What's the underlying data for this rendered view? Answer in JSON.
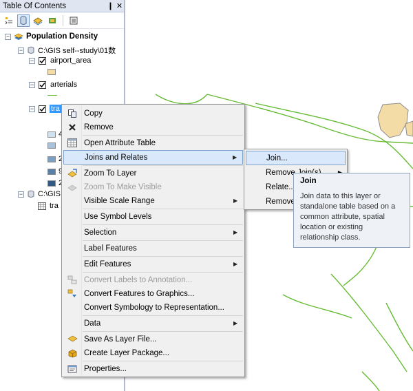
{
  "toc": {
    "title": "Table Of Contents",
    "pin_glyph": "❙",
    "close_glyph": "✕",
    "toolbar_icons": [
      "list-by-drawing-order-icon",
      "list-by-source-icon",
      "list-by-visibility-icon",
      "list-by-selection-icon",
      "options-icon"
    ],
    "root_layer": "Population Density",
    "workspace1": "C:\\GIS  self--study\\01数",
    "layers": [
      {
        "name": "airport_area",
        "checked": true,
        "swatch": "#f4dca6"
      },
      {
        "name": "arterials",
        "checked": true
      },
      {
        "name": "tra",
        "checked": true,
        "selected": true
      }
    ],
    "class_labels": [
      "4",
      "2",
      "2",
      "9",
      "2"
    ],
    "class_colors": [
      "#cfe0ee",
      "#a9c2db",
      "#7b9fc2",
      "#5a7fa6",
      "#2f5a86"
    ],
    "workspace2": "C:\\GIS",
    "table_item": "tra"
  },
  "context_menu": {
    "items": [
      {
        "label": "Copy",
        "icon": "copy-icon"
      },
      {
        "label": "Remove",
        "icon": "remove-icon"
      },
      {
        "label": "Open Attribute Table",
        "icon": "table-icon"
      },
      {
        "label": "Joins and Relates",
        "submenu": true,
        "highlighted": true
      },
      {
        "label": "Zoom To Layer",
        "icon": "zoom-to-layer-icon"
      },
      {
        "label": "Zoom To Make Visible",
        "icon": "zoom-visible-icon",
        "disabled": true
      },
      {
        "label": "Visible Scale Range",
        "submenu": true
      },
      {
        "label": "Use Symbol Levels"
      },
      {
        "label": "Selection",
        "submenu": true
      },
      {
        "label": "Label Features"
      },
      {
        "label": "Edit Features",
        "submenu": true
      },
      {
        "label": "Convert Labels to Annotation...",
        "icon": "convert-labels-icon",
        "disabled": true
      },
      {
        "label": "Convert Features to Graphics...",
        "icon": "convert-features-icon"
      },
      {
        "label": "Convert Symbology to Representation..."
      },
      {
        "label": "Data",
        "submenu": true
      },
      {
        "label": "Save As Layer File...",
        "icon": "save-layer-icon"
      },
      {
        "label": "Create Layer Package...",
        "icon": "layer-package-icon"
      },
      {
        "label": "Properties...",
        "icon": "properties-icon"
      }
    ]
  },
  "joins_submenu": {
    "items": [
      {
        "label": "Join...",
        "highlighted": true
      },
      {
        "label": "Remove Join(s)",
        "submenu": true
      },
      {
        "label": "Relate..."
      },
      {
        "label": "Remove Relate(s)",
        "submenu": true
      }
    ]
  },
  "tooltip": {
    "title": "Join",
    "body": "Join data to this layer or standalone table based on a common attribute, spatial location or existing relationship class."
  },
  "colors": {
    "selection_blue": "#3399ff",
    "menu_highlight": "#d9e8fa",
    "map_lines": "#66bb33",
    "map_polygon": "#f4dca6"
  }
}
